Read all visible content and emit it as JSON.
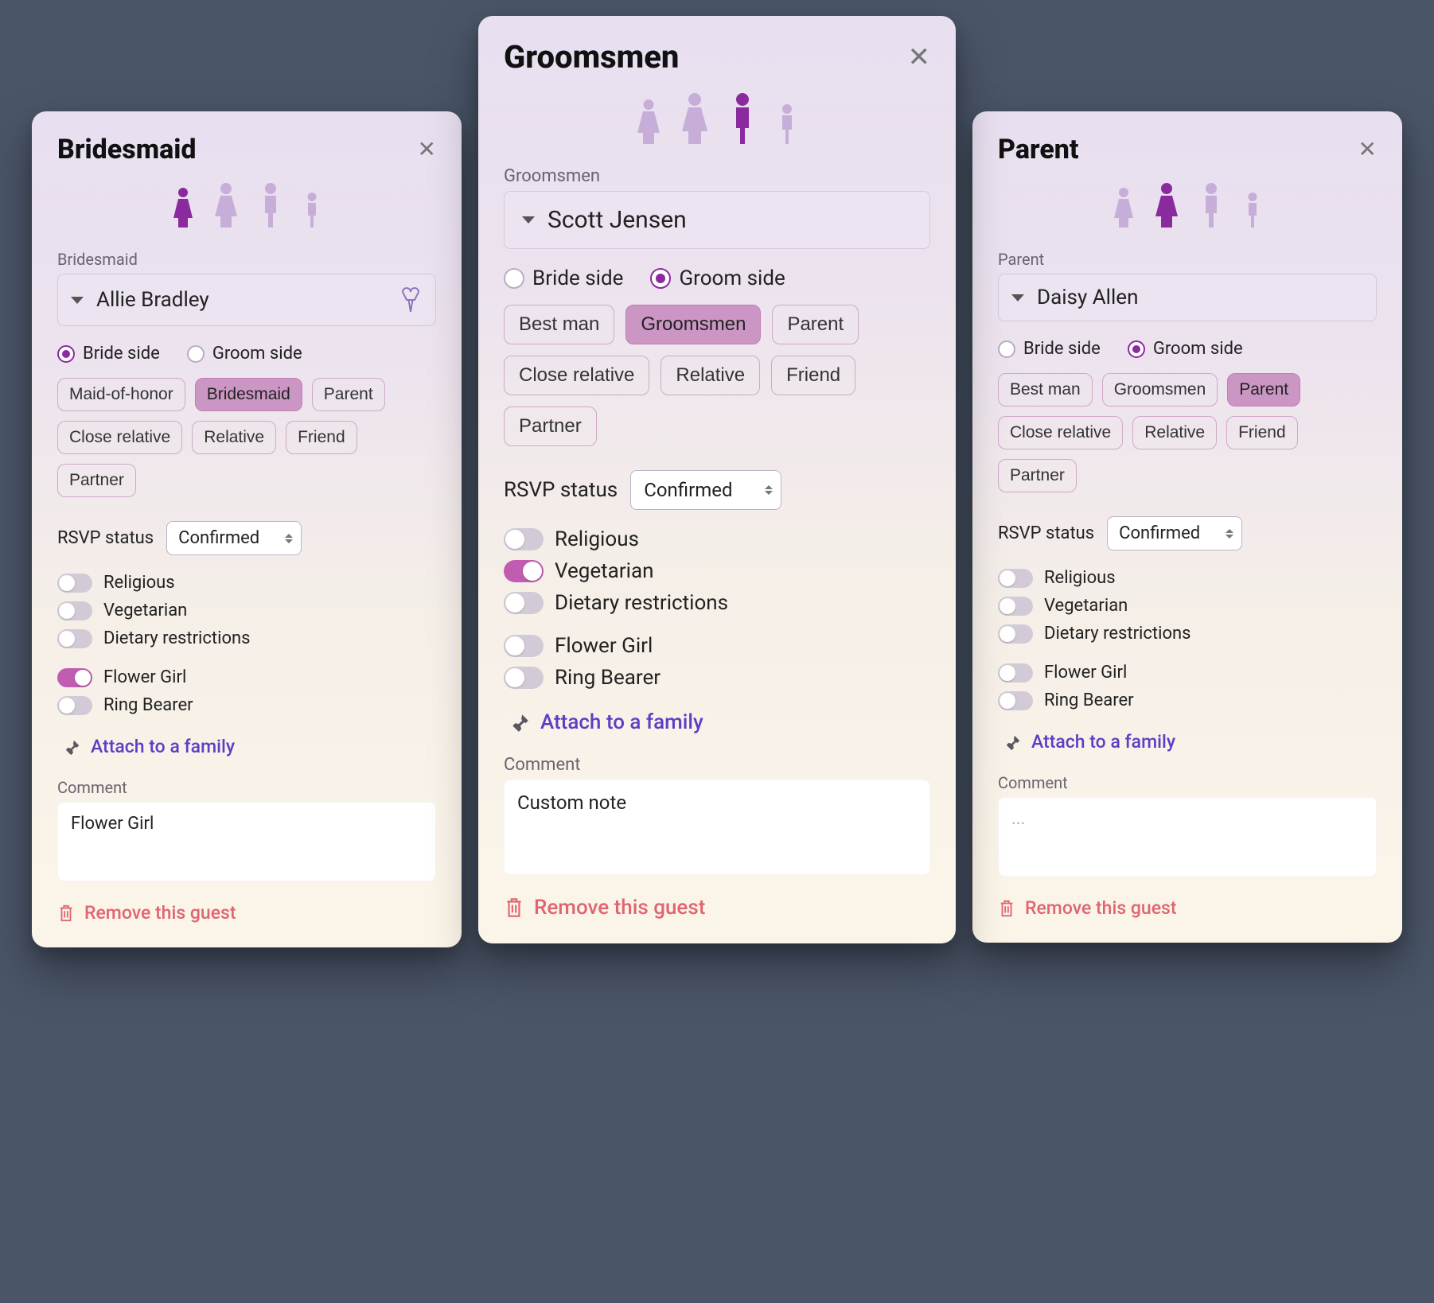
{
  "common": {
    "side_bride_label": "Bride side",
    "side_groom_label": "Groom side",
    "rsvp_label": "RSVP status",
    "rsvp_value": "Confirmed",
    "toggle_religious": "Religious",
    "toggle_vegetarian": "Vegetarian",
    "toggle_dietary": "Dietary restrictions",
    "toggle_flowergirl": "Flower Girl",
    "toggle_ringbearer": "Ring Bearer",
    "attach_label": "Attach to a family",
    "comment_label": "Comment",
    "comment_placeholder": "...",
    "remove_label": "Remove this guest",
    "bride_roles": [
      "Maid-of-honor",
      "Bridesmaid",
      "Parent",
      "Close relative",
      "Relative",
      "Friend",
      "Partner"
    ],
    "groom_roles": [
      "Best man",
      "Groomsmen",
      "Parent",
      "Close relative",
      "Relative",
      "Friend",
      "Partner"
    ]
  },
  "cards": {
    "left": {
      "title": "Bridesmaid",
      "role_label": "Bridesmaid",
      "name": "Allie Bradley",
      "side_selected": "bride",
      "avatar_selected": 0,
      "role_selected": "Bridesmaid",
      "religious": false,
      "vegetarian": false,
      "dietary": false,
      "flowergirl": true,
      "ringbearer": false,
      "comment": "Flower Girl",
      "show_bouquet": true
    },
    "center": {
      "title": "Groomsmen",
      "role_label": "Groomsmen",
      "name": "Scott Jensen",
      "side_selected": "groom",
      "avatar_selected": 2,
      "role_selected": "Groomsmen",
      "religious": false,
      "vegetarian": true,
      "dietary": false,
      "flowergirl": false,
      "ringbearer": false,
      "comment": "Custom note",
      "show_bouquet": false
    },
    "right": {
      "title": "Parent",
      "role_label": "Parent",
      "name": "Daisy Allen",
      "side_selected": "groom",
      "avatar_selected": 1,
      "role_selected": "Parent",
      "religious": false,
      "vegetarian": false,
      "dietary": false,
      "flowergirl": false,
      "ringbearer": false,
      "comment": "",
      "show_bouquet": false
    }
  }
}
